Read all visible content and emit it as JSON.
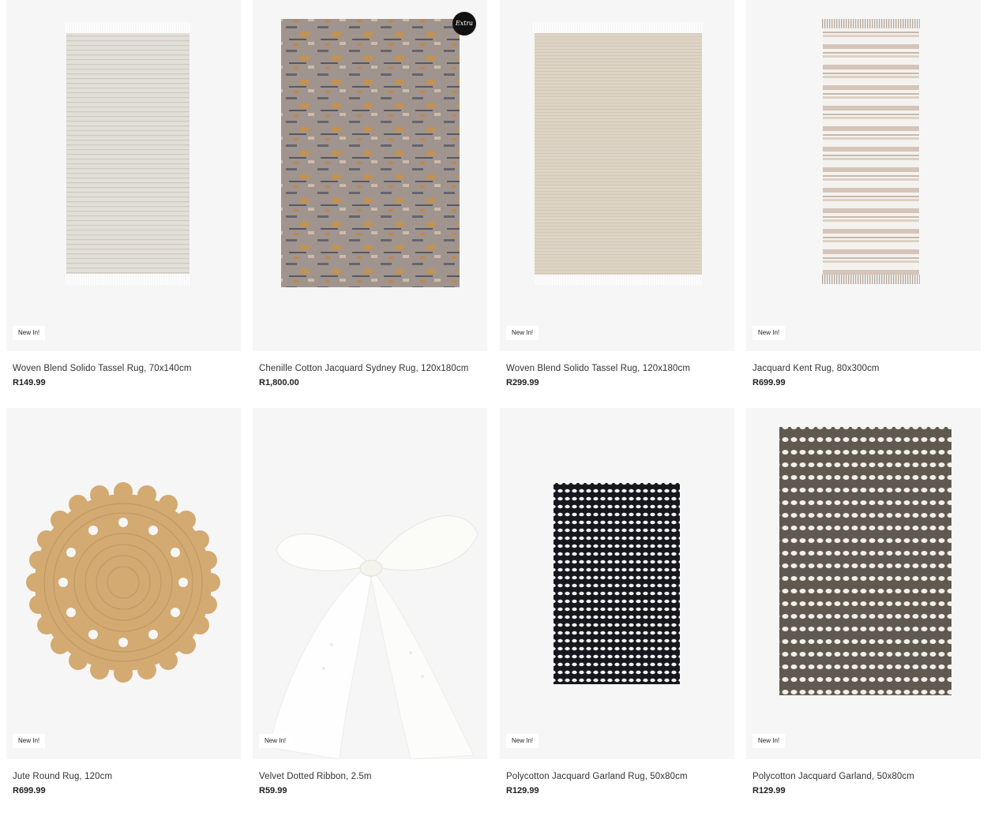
{
  "products": [
    {
      "title": "Woven Blend Solido Tassel Rug, 70x140cm",
      "price": "R149.99",
      "badge": "New In!",
      "image_icon": "beige-striped-tassel-rug-image"
    },
    {
      "title": "Chenille Cotton Jacquard Sydney Rug, 120x180cm",
      "price": "R1,800.00",
      "badge": "",
      "image_icon": "distressed-grey-orange-rug-image",
      "brand_logo": "Extra"
    },
    {
      "title": "Woven Blend Solido Tassel Rug, 120x180cm",
      "price": "R299.99",
      "badge": "New In!",
      "image_icon": "beige-tassel-rug-image"
    },
    {
      "title": "Jacquard Kent Rug, 80x300cm",
      "price": "R699.99",
      "badge": "New In!",
      "image_icon": "striped-runner-rug-image"
    },
    {
      "title": "Jute Round Rug, 120cm",
      "price": "R699.99",
      "badge": "New In!",
      "image_icon": "round-jute-rug-image"
    },
    {
      "title": "Velvet Dotted Ribbon, 2.5m",
      "price": "R59.99",
      "badge": "New In!",
      "image_icon": "white-ribbon-bow-image"
    },
    {
      "title": "Polycotton Jacquard Garland Rug, 50x80cm",
      "price": "R129.99",
      "badge": "New In!",
      "image_icon": "black-white-dotted-rug-image"
    },
    {
      "title": "Polycotton Jacquard Garland, 50x80cm",
      "price": "R129.99",
      "badge": "New In!",
      "image_icon": "brown-white-dotted-rug-image"
    }
  ],
  "colors": {
    "card_bg": "#f6f6f6",
    "price": "#222222",
    "jute": "#d2aa72",
    "dark_rug": "#17181f",
    "brown_rug": "#5f5950"
  }
}
